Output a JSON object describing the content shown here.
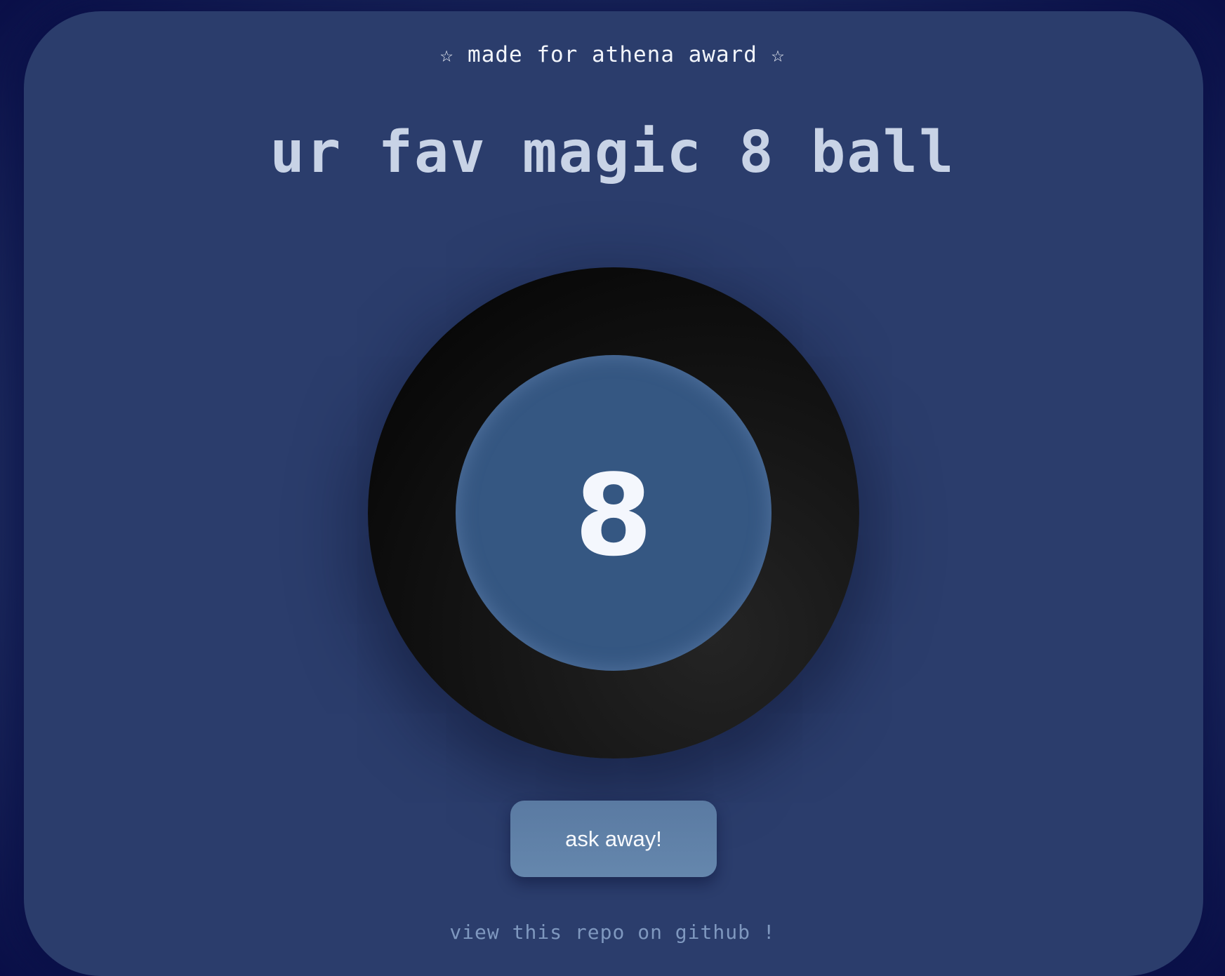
{
  "header": {
    "subtitle": "☆ made for athena award ☆",
    "title": "ur fav magic 8 ball"
  },
  "ball": {
    "number": "8"
  },
  "actions": {
    "ask_label": "ask away!"
  },
  "footer": {
    "repo_link": "view this repo on github !"
  },
  "colors": {
    "background": "#0a0f48",
    "panel": "#2b3d6c",
    "ball": "#111111",
    "window": "#355782",
    "button": "#6587ad"
  }
}
